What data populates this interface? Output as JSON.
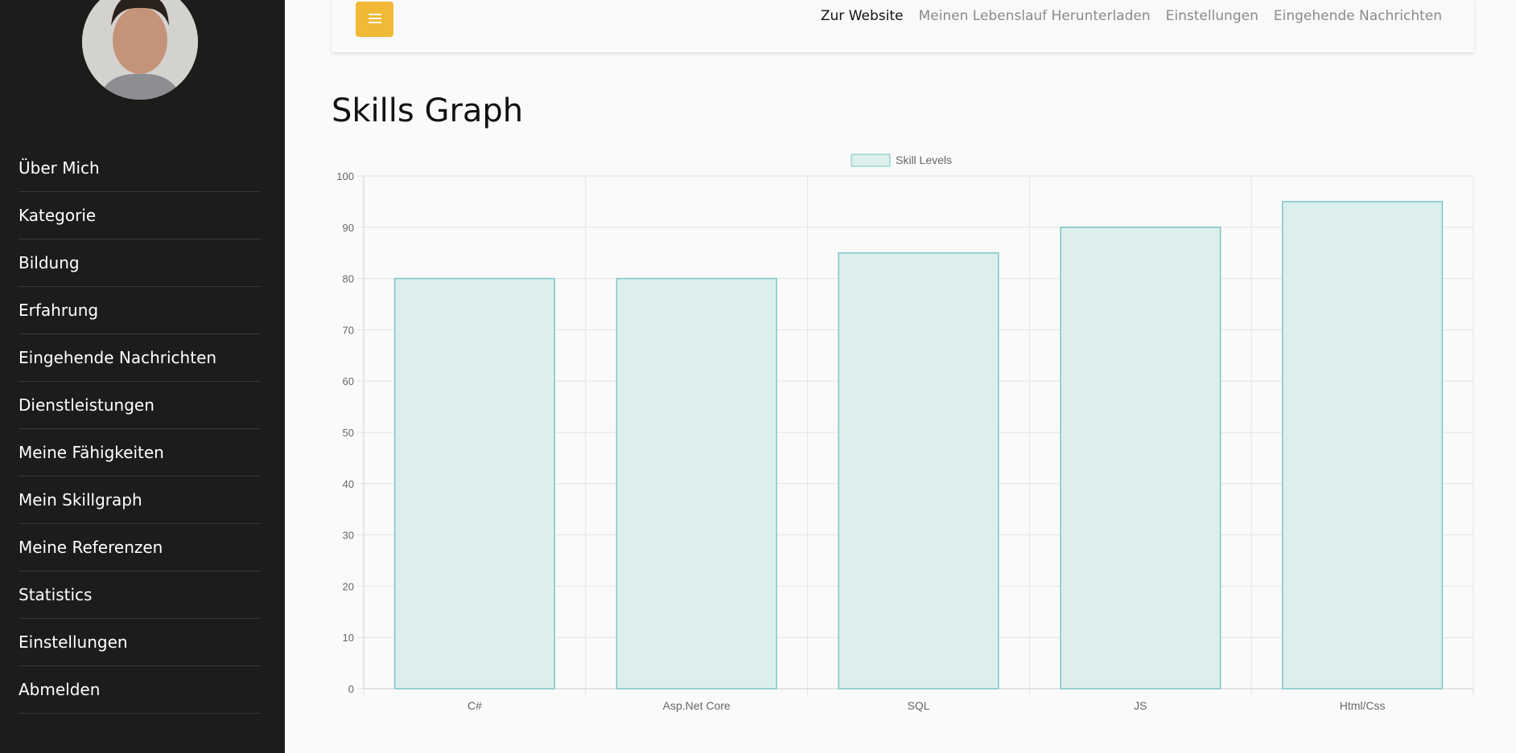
{
  "sidebar": {
    "items": [
      {
        "label": "Über Mich"
      },
      {
        "label": "Kategorie"
      },
      {
        "label": "Bildung"
      },
      {
        "label": "Erfahrung"
      },
      {
        "label": "Eingehende Nachrichten"
      },
      {
        "label": "Dienstleistungen"
      },
      {
        "label": "Meine Fähigkeiten"
      },
      {
        "label": "Mein Skillgraph"
      },
      {
        "label": "Meine Referenzen"
      },
      {
        "label": "Statistics"
      },
      {
        "label": "Einstellungen"
      },
      {
        "label": "Abmelden"
      }
    ]
  },
  "topbar": {
    "menu_icon": "hamburger-icon",
    "links": [
      {
        "label": "Zur Website",
        "active": true
      },
      {
        "label": "Meinen Lebenslauf Herunterladen"
      },
      {
        "label": "Einstellungen"
      },
      {
        "label": "Eingehende Nachrichten"
      }
    ],
    "menu_button_color": "#f1b935"
  },
  "page": {
    "title": "Skills Graph"
  },
  "chart_data": {
    "type": "bar",
    "categories": [
      "C#",
      "Asp.Net Core",
      "SQL",
      "JS",
      "Html/Css"
    ],
    "series": [
      {
        "name": "Skill Levels",
        "values": [
          80,
          80,
          85,
          90,
          95
        ]
      }
    ],
    "ylim": [
      0,
      100
    ],
    "yticks": [
      0,
      10,
      20,
      30,
      40,
      50,
      60,
      70,
      80,
      90,
      100
    ],
    "grid": true,
    "legend": "top-center",
    "bar_fill": "#dcefed",
    "bar_stroke": "#7bc5c8"
  }
}
